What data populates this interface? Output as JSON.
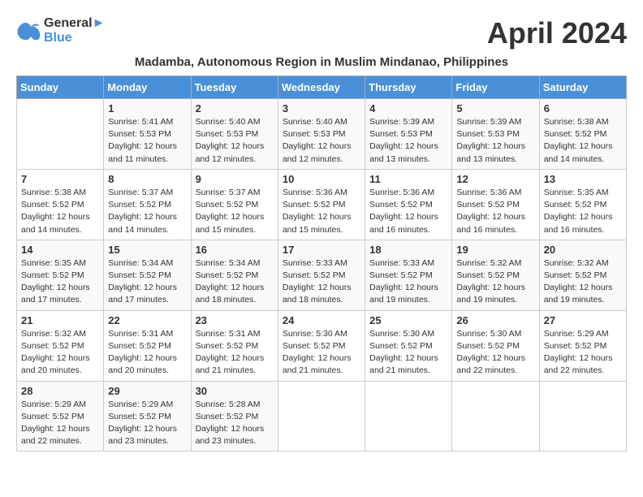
{
  "header": {
    "logo_line1": "General",
    "logo_line2": "Blue",
    "month_title": "April 2024",
    "subtitle": "Madamba, Autonomous Region in Muslim Mindanao, Philippines"
  },
  "days_of_week": [
    "Sunday",
    "Monday",
    "Tuesday",
    "Wednesday",
    "Thursday",
    "Friday",
    "Saturday"
  ],
  "weeks": [
    [
      {
        "day": "",
        "sunrise": "",
        "sunset": "",
        "daylight": ""
      },
      {
        "day": "1",
        "sunrise": "Sunrise: 5:41 AM",
        "sunset": "Sunset: 5:53 PM",
        "daylight": "Daylight: 12 hours and 11 minutes."
      },
      {
        "day": "2",
        "sunrise": "Sunrise: 5:40 AM",
        "sunset": "Sunset: 5:53 PM",
        "daylight": "Daylight: 12 hours and 12 minutes."
      },
      {
        "day": "3",
        "sunrise": "Sunrise: 5:40 AM",
        "sunset": "Sunset: 5:53 PM",
        "daylight": "Daylight: 12 hours and 12 minutes."
      },
      {
        "day": "4",
        "sunrise": "Sunrise: 5:39 AM",
        "sunset": "Sunset: 5:53 PM",
        "daylight": "Daylight: 12 hours and 13 minutes."
      },
      {
        "day": "5",
        "sunrise": "Sunrise: 5:39 AM",
        "sunset": "Sunset: 5:53 PM",
        "daylight": "Daylight: 12 hours and 13 minutes."
      },
      {
        "day": "6",
        "sunrise": "Sunrise: 5:38 AM",
        "sunset": "Sunset: 5:52 PM",
        "daylight": "Daylight: 12 hours and 14 minutes."
      }
    ],
    [
      {
        "day": "7",
        "sunrise": "Sunrise: 5:38 AM",
        "sunset": "Sunset: 5:52 PM",
        "daylight": "Daylight: 12 hours and 14 minutes."
      },
      {
        "day": "8",
        "sunrise": "Sunrise: 5:37 AM",
        "sunset": "Sunset: 5:52 PM",
        "daylight": "Daylight: 12 hours and 14 minutes."
      },
      {
        "day": "9",
        "sunrise": "Sunrise: 5:37 AM",
        "sunset": "Sunset: 5:52 PM",
        "daylight": "Daylight: 12 hours and 15 minutes."
      },
      {
        "day": "10",
        "sunrise": "Sunrise: 5:36 AM",
        "sunset": "Sunset: 5:52 PM",
        "daylight": "Daylight: 12 hours and 15 minutes."
      },
      {
        "day": "11",
        "sunrise": "Sunrise: 5:36 AM",
        "sunset": "Sunset: 5:52 PM",
        "daylight": "Daylight: 12 hours and 16 minutes."
      },
      {
        "day": "12",
        "sunrise": "Sunrise: 5:36 AM",
        "sunset": "Sunset: 5:52 PM",
        "daylight": "Daylight: 12 hours and 16 minutes."
      },
      {
        "day": "13",
        "sunrise": "Sunrise: 5:35 AM",
        "sunset": "Sunset: 5:52 PM",
        "daylight": "Daylight: 12 hours and 16 minutes."
      }
    ],
    [
      {
        "day": "14",
        "sunrise": "Sunrise: 5:35 AM",
        "sunset": "Sunset: 5:52 PM",
        "daylight": "Daylight: 12 hours and 17 minutes."
      },
      {
        "day": "15",
        "sunrise": "Sunrise: 5:34 AM",
        "sunset": "Sunset: 5:52 PM",
        "daylight": "Daylight: 12 hours and 17 minutes."
      },
      {
        "day": "16",
        "sunrise": "Sunrise: 5:34 AM",
        "sunset": "Sunset: 5:52 PM",
        "daylight": "Daylight: 12 hours and 18 minutes."
      },
      {
        "day": "17",
        "sunrise": "Sunrise: 5:33 AM",
        "sunset": "Sunset: 5:52 PM",
        "daylight": "Daylight: 12 hours and 18 minutes."
      },
      {
        "day": "18",
        "sunrise": "Sunrise: 5:33 AM",
        "sunset": "Sunset: 5:52 PM",
        "daylight": "Daylight: 12 hours and 19 minutes."
      },
      {
        "day": "19",
        "sunrise": "Sunrise: 5:32 AM",
        "sunset": "Sunset: 5:52 PM",
        "daylight": "Daylight: 12 hours and 19 minutes."
      },
      {
        "day": "20",
        "sunrise": "Sunrise: 5:32 AM",
        "sunset": "Sunset: 5:52 PM",
        "daylight": "Daylight: 12 hours and 19 minutes."
      }
    ],
    [
      {
        "day": "21",
        "sunrise": "Sunrise: 5:32 AM",
        "sunset": "Sunset: 5:52 PM",
        "daylight": "Daylight: 12 hours and 20 minutes."
      },
      {
        "day": "22",
        "sunrise": "Sunrise: 5:31 AM",
        "sunset": "Sunset: 5:52 PM",
        "daylight": "Daylight: 12 hours and 20 minutes."
      },
      {
        "day": "23",
        "sunrise": "Sunrise: 5:31 AM",
        "sunset": "Sunset: 5:52 PM",
        "daylight": "Daylight: 12 hours and 21 minutes."
      },
      {
        "day": "24",
        "sunrise": "Sunrise: 5:30 AM",
        "sunset": "Sunset: 5:52 PM",
        "daylight": "Daylight: 12 hours and 21 minutes."
      },
      {
        "day": "25",
        "sunrise": "Sunrise: 5:30 AM",
        "sunset": "Sunset: 5:52 PM",
        "daylight": "Daylight: 12 hours and 21 minutes."
      },
      {
        "day": "26",
        "sunrise": "Sunrise: 5:30 AM",
        "sunset": "Sunset: 5:52 PM",
        "daylight": "Daylight: 12 hours and 22 minutes."
      },
      {
        "day": "27",
        "sunrise": "Sunrise: 5:29 AM",
        "sunset": "Sunset: 5:52 PM",
        "daylight": "Daylight: 12 hours and 22 minutes."
      }
    ],
    [
      {
        "day": "28",
        "sunrise": "Sunrise: 5:29 AM",
        "sunset": "Sunset: 5:52 PM",
        "daylight": "Daylight: 12 hours and 22 minutes."
      },
      {
        "day": "29",
        "sunrise": "Sunrise: 5:29 AM",
        "sunset": "Sunset: 5:52 PM",
        "daylight": "Daylight: 12 hours and 23 minutes."
      },
      {
        "day": "30",
        "sunrise": "Sunrise: 5:28 AM",
        "sunset": "Sunset: 5:52 PM",
        "daylight": "Daylight: 12 hours and 23 minutes."
      },
      {
        "day": "",
        "sunrise": "",
        "sunset": "",
        "daylight": ""
      },
      {
        "day": "",
        "sunrise": "",
        "sunset": "",
        "daylight": ""
      },
      {
        "day": "",
        "sunrise": "",
        "sunset": "",
        "daylight": ""
      },
      {
        "day": "",
        "sunrise": "",
        "sunset": "",
        "daylight": ""
      }
    ]
  ]
}
